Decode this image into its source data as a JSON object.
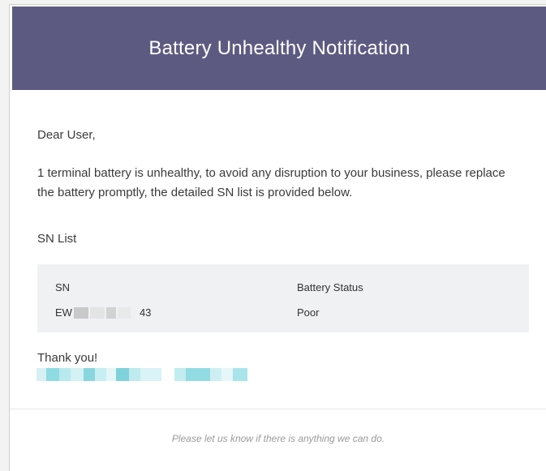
{
  "header": {
    "title": "Battery Unhealthy Notification",
    "background_color": "#5d5a82"
  },
  "content": {
    "greeting": "Dear User,",
    "message": "1 terminal battery is unhealthy, to avoid any disruption to your business, please replace the battery promptly, the detailed SN list is provided below.",
    "sn_list_label": "SN List"
  },
  "sn_table": {
    "background_color": "#eff1f3",
    "columns": [
      "SN",
      "Battery Status"
    ],
    "rows": [
      {
        "sn_prefix": "EW",
        "sn_suffix": "43",
        "status": "Poor"
      }
    ]
  },
  "closing": {
    "thanks": "Thank you!"
  },
  "footer": {
    "note": "Please let us know if there is anything we can do."
  }
}
